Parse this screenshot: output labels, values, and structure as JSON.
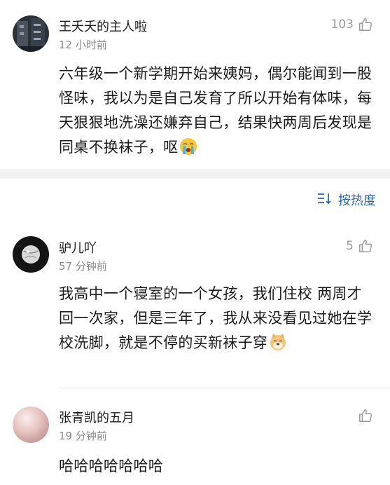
{
  "comments": [
    {
      "username": "王夭夭的主人啦",
      "time": "12 小时前",
      "likes": "103",
      "text": "六年级一个新学期开始来姨妈，偶尔能闻到一股怪味，我以为是自己发育了所以开始有体味，每天狠狠地洗澡还嫌弃自己，结果快两周后发现是同桌不换袜子，呕",
      "emoji": "crying-face-icon"
    },
    {
      "username": "驴儿吖",
      "time": "57 分钟前",
      "likes": "5",
      "text": "我高中一个寝室的一个女孩，我们住校 两周才回一次家，但是三年了，我从来没看见过她在学校洗脚，就是不停的买新袜子穿",
      "emoji": "doge-icon"
    },
    {
      "username": "张青凯的五月",
      "time": "19 分钟前",
      "likes": "",
      "text": "哈哈哈哈哈哈哈"
    }
  ],
  "sort": {
    "label": "按热度",
    "icon": "sort-icon"
  },
  "colors": {
    "accent": "#2a66a8",
    "meta": "#8c8c8c",
    "band": "#f2f2f2"
  }
}
